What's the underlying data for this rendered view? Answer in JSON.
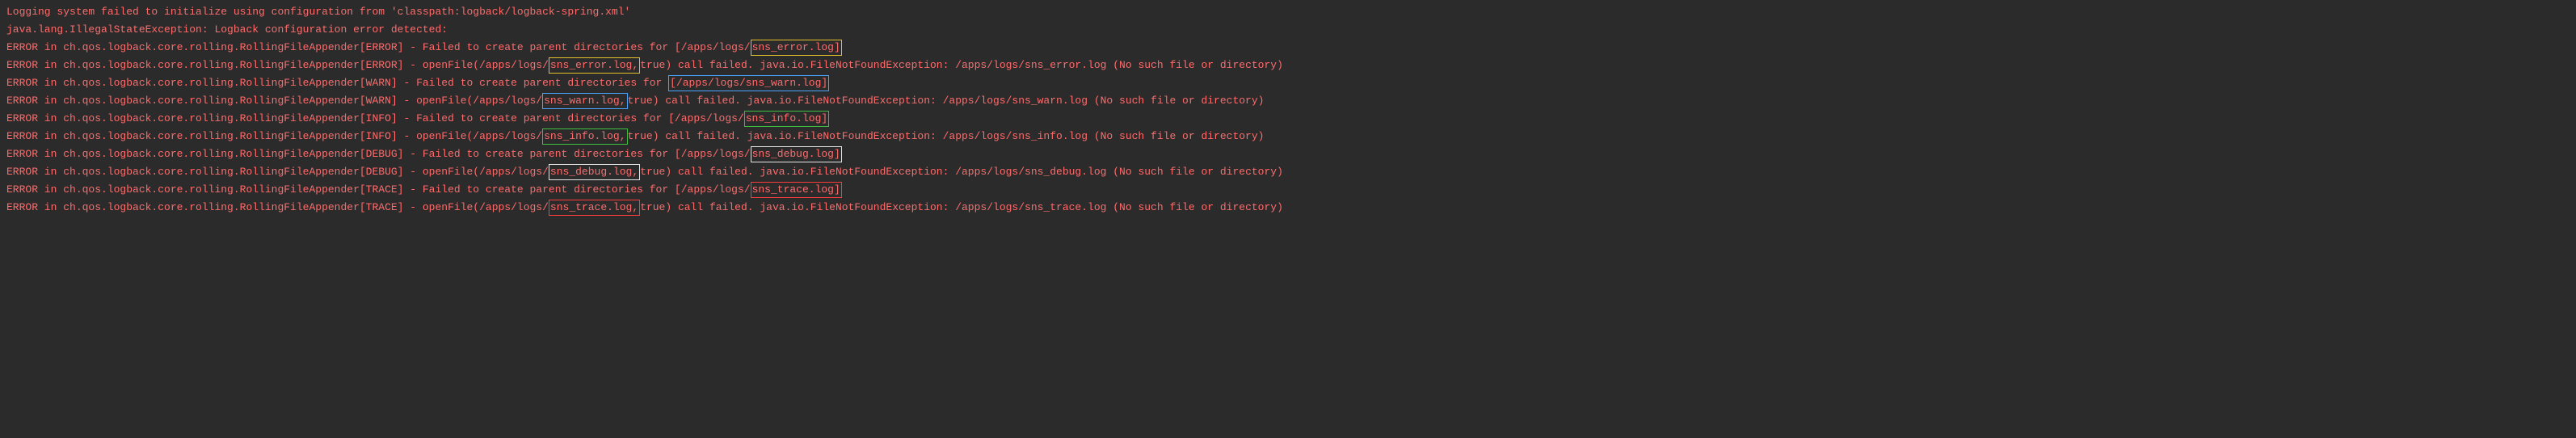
{
  "colors": {
    "background": "#2b2b2b",
    "text": "#ff6b6b",
    "highlight_yellow": "#e6c029",
    "highlight_blue": "#4aa3ff",
    "highlight_green": "#3fbf3f",
    "highlight_white": "#e6e6e6",
    "highlight_red": "#ff3b3b"
  },
  "log": {
    "header1": "Logging system failed to initialize using configuration from 'classpath:logback/logback-spring.xml'",
    "header2": "java.lang.IllegalStateException: Logback configuration error detected:",
    "l1_pre": "ERROR in ch.qos.logback.core.rolling.RollingFileAppender[ERROR] - Failed to create parent directories for [/apps/logs/",
    "l1_hl": "sns_error.log]",
    "l2_pre": "ERROR in ch.qos.logback.core.rolling.RollingFileAppender[ERROR] - openFile(/apps/logs/",
    "l2_hl": "sns_error.log,",
    "l2_post": "true) call failed. java.io.FileNotFoundException: /apps/logs/sns_error.log (No such file or directory)",
    "l3_pre": "ERROR in ch.qos.logback.core.rolling.RollingFileAppender[WARN] - Failed to create parent directories for ",
    "l3_hl": "[/apps/logs/sns_warn.log]",
    "l4_pre": "ERROR in ch.qos.logback.core.rolling.RollingFileAppender[WARN] - openFile(/apps/logs/",
    "l4_hl": "sns_warn.log,",
    "l4_post": "true) call failed. java.io.FileNotFoundException: /apps/logs/sns_warn.log (No such file or directory)",
    "l5_pre": "ERROR in ch.qos.logback.core.rolling.RollingFileAppender[INFO] - Failed to create parent directories for [/apps/logs/",
    "l5_hl": "sns_info.log]",
    "l6_pre": "ERROR in ch.qos.logback.core.rolling.RollingFileAppender[INFO] - openFile(/apps/logs/",
    "l6_hl": "sns_info.log,",
    "l6_post": "true) call failed. java.io.FileNotFoundException: /apps/logs/sns_info.log (No such file or directory)",
    "l7_pre": "ERROR in ch.qos.logback.core.rolling.RollingFileAppender[DEBUG] - Failed to create parent directories for [/apps/logs/",
    "l7_hl": "sns_debug.log]",
    "l8_pre": "ERROR in ch.qos.logback.core.rolling.RollingFileAppender[DEBUG] - openFile(/apps/logs/",
    "l8_hl": "sns_debug.log,",
    "l8_post": "true) call failed. java.io.FileNotFoundException: /apps/logs/sns_debug.log (No such file or directory)",
    "l9_pre": "ERROR in ch.qos.logback.core.rolling.RollingFileAppender[TRACE] - Failed to create parent directories for [/apps/logs/",
    "l9_hl": "sns_trace.log]",
    "l10_pre": "ERROR in ch.qos.logback.core.rolling.RollingFileAppender[TRACE] - openFile(/apps/logs/",
    "l10_hl": "sns_trace.log,",
    "l10_post": "true) call failed. java.io.FileNotFoundException: /apps/logs/sns_trace.log (No such file or directory)"
  }
}
